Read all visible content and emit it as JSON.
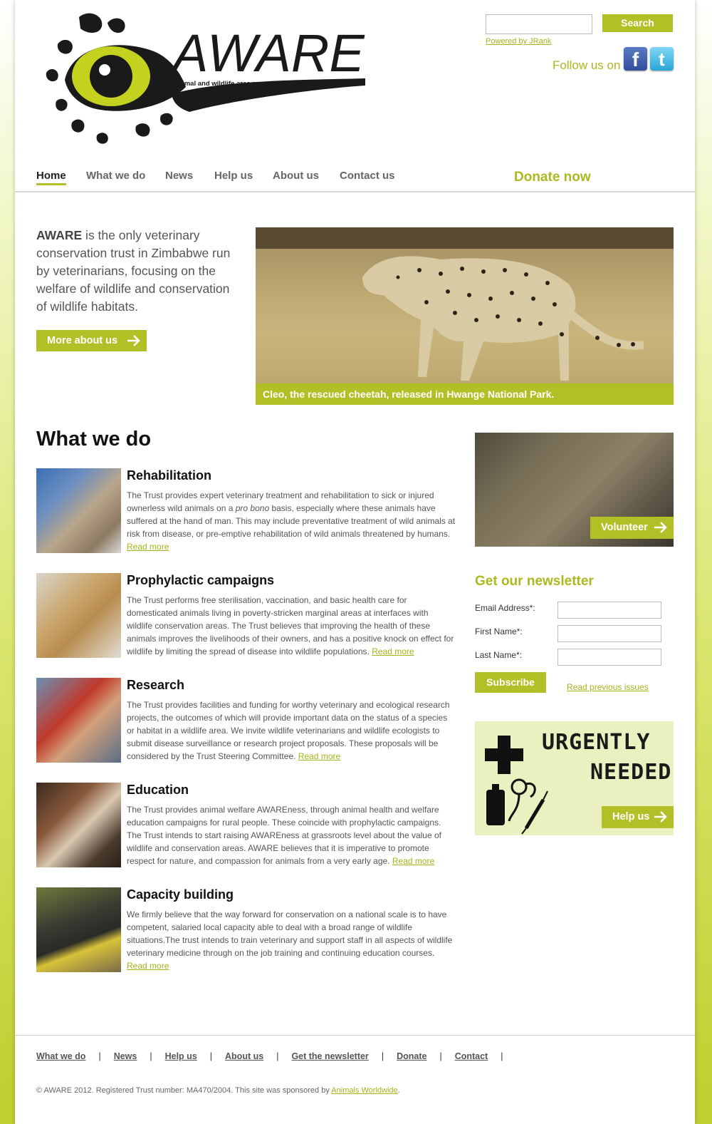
{
  "header": {
    "logo_title": "AWARE",
    "logo_subtitle": "animal and wildlife area research and rehabilitation",
    "search_button": "Search",
    "search_placeholder": "",
    "powered_by": "Powered by JRank",
    "follow_us": "Follow us on",
    "social": [
      {
        "name": "facebook-icon",
        "glyph": "f"
      },
      {
        "name": "twitter-icon",
        "glyph": "t"
      }
    ]
  },
  "nav": {
    "items": [
      {
        "label": "Home",
        "active": true
      },
      {
        "label": "What we do"
      },
      {
        "label": "News"
      },
      {
        "label": "Help us"
      },
      {
        "label": "About us"
      },
      {
        "label": "Contact us"
      }
    ],
    "donate": "Donate now"
  },
  "intro": {
    "brand": "AWARE",
    "text": " is the only veterinary conservation trust in Zimbabwe run by veterinarians, focusing on the welfare of wildlife and conservation of wildlife habitats.",
    "button": "More about us",
    "hero_caption": "Cleo, the rescued cheetah, released in Hwange National Park."
  },
  "what_we_do": {
    "title": "What we do",
    "read_more": "Read more",
    "items": [
      {
        "title": "Rehabilitation",
        "text_before_italic": "The Trust provides expert veterinary treatment and rehabilitation to sick or injured ownerless wild animals on a ",
        "italic": "pro bono",
        "text": " basis, especially where these animals have suffered at the hand of man. This may include preventative treatment of wild animals at risk from disease, or pre-emptive rehabilitation of wild animals threatened by humans."
      },
      {
        "title": "Prophylactic campaigns",
        "text": "The Trust performs free sterilisation, vaccination, and basic health care for domesticated animals living in poverty-stricken marginal areas at interfaces with wildlife conservation areas. The Trust believes that improving the health of these animals improves the livelihoods of their owners, and has a positive knock on effect for wildlife by limiting the spread of disease into wildlife populations."
      },
      {
        "title": "Research",
        "text": "The Trust provides facilities and funding for worthy veterinary and ecological research projects, the outcomes of which will provide important data on the status of a species or habitat in a wildlife area. We invite wildlife veterinarians and wildlife ecologists to submit disease surveillance or research project proposals. These proposals will be considered by the Trust Steering Committee."
      },
      {
        "title": "Education",
        "text": "The Trust provides animal welfare AWAREness, through animal health and welfare education campaigns for rural people. These coincide with prophylactic campaigns. The Trust intends to start raising AWAREness at grassroots level about the value of wildlife and conservation areas. AWARE believes that it is imperative to promote respect for nature, and compassion for animals from a very early age."
      },
      {
        "title": "Capacity building",
        "text": "We firmly believe that the way forward for conservation on a national scale is to have competent, salaried local capacity able to deal with a broad range of wildlife situations.The trust intends to train veterinary and support staff in all aspects of wildlife veterinary medicine through on the job training and continuing education courses."
      }
    ]
  },
  "sidebar": {
    "volunteer": "Volunteer",
    "newsletter_title": "Get our newsletter",
    "fields": [
      {
        "label": "Email Address*:",
        "value": ""
      },
      {
        "label": "First Name*:",
        "value": ""
      },
      {
        "label": "Last Name*:",
        "value": ""
      }
    ],
    "subscribe": "Subscribe",
    "previous_issues": "Read previous issues",
    "urgent_line1": "URGENTLY",
    "urgent_line2": "NEEDED",
    "help_us": "Help us"
  },
  "footer": {
    "links": [
      "What we do",
      "News",
      "Help us",
      "About us",
      "Get the newsletter",
      "Donate",
      "Contact"
    ],
    "separator": "|",
    "copyright": "© AWARE 2012. Registered Trust number: MA470/2004. This site was sponsored by ",
    "sponsor": "Animals Worldwide",
    "copyright_end": "."
  },
  "colors": {
    "accent": "#b2bf26",
    "accent_text": "#a9b91e"
  }
}
